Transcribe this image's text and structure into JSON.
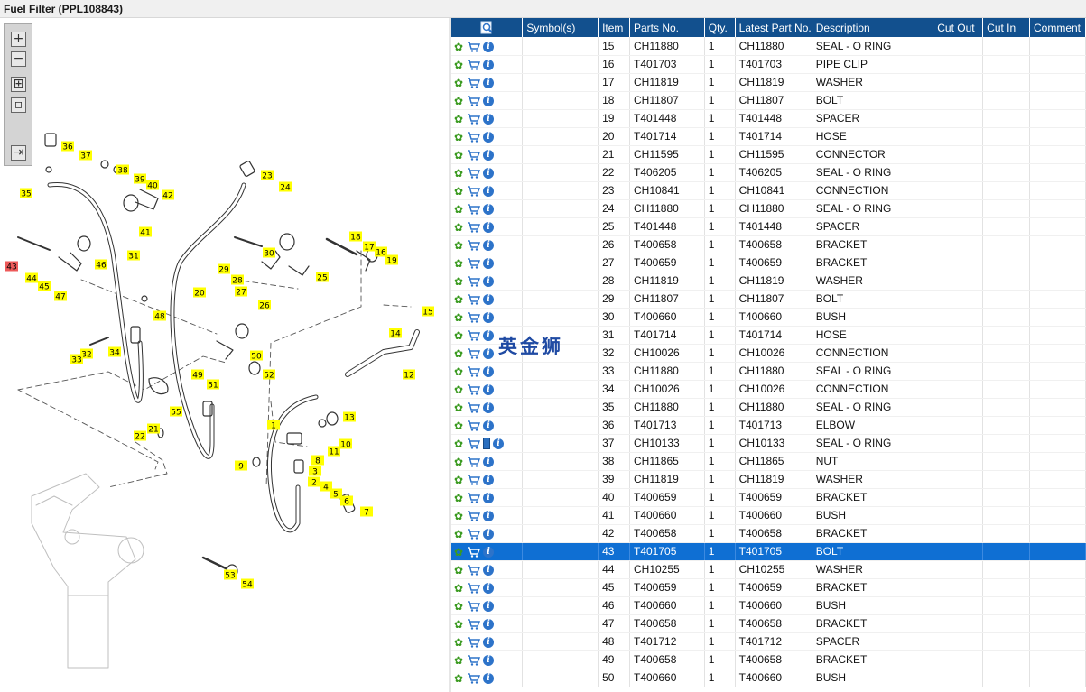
{
  "window": {
    "title": "Fuel Filter (PPL108843)"
  },
  "toolbar": {
    "tools": [
      {
        "name": "zoom-in-icon",
        "glyph": "+"
      },
      {
        "name": "zoom-out-icon",
        "glyph": "−"
      },
      {
        "name": "fit-all-icon",
        "glyph": "⊞"
      },
      {
        "name": "fit-window-icon",
        "glyph": "▫"
      },
      {
        "name": "panel-toggle-icon",
        "glyph": "⇥"
      }
    ]
  },
  "watermark": "英金狮",
  "colors": {
    "header_bg": "#12508e",
    "selected_row": "#0f6fd3",
    "callout": "#ffff00",
    "callout_selected": "#ee5a5a",
    "gear": "#3a9a1f",
    "info": "#2d73c9"
  },
  "diagram": {
    "selected_callout": "43",
    "callouts": [
      {
        "n": "1"
      },
      {
        "n": "2"
      },
      {
        "n": "3"
      },
      {
        "n": "4"
      },
      {
        "n": "5"
      },
      {
        "n": "6"
      },
      {
        "n": "7"
      },
      {
        "n": "8"
      },
      {
        "n": "9"
      },
      {
        "n": "10"
      },
      {
        "n": "11"
      },
      {
        "n": "12"
      },
      {
        "n": "13"
      },
      {
        "n": "14"
      },
      {
        "n": "15"
      },
      {
        "n": "16"
      },
      {
        "n": "17"
      },
      {
        "n": "18"
      },
      {
        "n": "19"
      },
      {
        "n": "20"
      },
      {
        "n": "21"
      },
      {
        "n": "22"
      },
      {
        "n": "23"
      },
      {
        "n": "24"
      },
      {
        "n": "25"
      },
      {
        "n": "26"
      },
      {
        "n": "27"
      },
      {
        "n": "28"
      },
      {
        "n": "29"
      },
      {
        "n": "30"
      },
      {
        "n": "31"
      },
      {
        "n": "32"
      },
      {
        "n": "33"
      },
      {
        "n": "34"
      },
      {
        "n": "35"
      },
      {
        "n": "36"
      },
      {
        "n": "37"
      },
      {
        "n": "38"
      },
      {
        "n": "39"
      },
      {
        "n": "40"
      },
      {
        "n": "41"
      },
      {
        "n": "42"
      },
      {
        "n": "43"
      },
      {
        "n": "44"
      },
      {
        "n": "45"
      },
      {
        "n": "46"
      },
      {
        "n": "47"
      },
      {
        "n": "48"
      },
      {
        "n": "49"
      },
      {
        "n": "50"
      },
      {
        "n": "51"
      },
      {
        "n": "52"
      },
      {
        "n": "53"
      },
      {
        "n": "54"
      },
      {
        "n": "55"
      }
    ]
  },
  "table": {
    "columns": [
      "",
      "Symbol(s)",
      "Item",
      "Parts No.",
      "Qty.",
      "Latest Part No.",
      "Description",
      "Cut Out",
      "Cut In",
      "Comment"
    ],
    "selected_item": "43",
    "rows": [
      {
        "item": "15",
        "part": "CH11880",
        "qty": "1",
        "latest": "CH11880",
        "desc": "SEAL - O RING"
      },
      {
        "item": "16",
        "part": "T401703",
        "qty": "1",
        "latest": "T401703",
        "desc": "PIPE CLIP"
      },
      {
        "item": "17",
        "part": "CH11819",
        "qty": "1",
        "latest": "CH11819",
        "desc": "WASHER"
      },
      {
        "item": "18",
        "part": "CH11807",
        "qty": "1",
        "latest": "CH11807",
        "desc": "BOLT"
      },
      {
        "item": "19",
        "part": "T401448",
        "qty": "1",
        "latest": "T401448",
        "desc": "SPACER"
      },
      {
        "item": "20",
        "part": "T401714",
        "qty": "1",
        "latest": "T401714",
        "desc": "HOSE"
      },
      {
        "item": "21",
        "part": "CH11595",
        "qty": "1",
        "latest": "CH11595",
        "desc": "CONNECTOR"
      },
      {
        "item": "22",
        "part": "T406205",
        "qty": "1",
        "latest": "T406205",
        "desc": "SEAL - O RING"
      },
      {
        "item": "23",
        "part": "CH10841",
        "qty": "1",
        "latest": "CH10841",
        "desc": "CONNECTION"
      },
      {
        "item": "24",
        "part": "CH11880",
        "qty": "1",
        "latest": "CH11880",
        "desc": "SEAL - O RING"
      },
      {
        "item": "25",
        "part": "T401448",
        "qty": "1",
        "latest": "T401448",
        "desc": "SPACER"
      },
      {
        "item": "26",
        "part": "T400658",
        "qty": "1",
        "latest": "T400658",
        "desc": "BRACKET"
      },
      {
        "item": "27",
        "part": "T400659",
        "qty": "1",
        "latest": "T400659",
        "desc": "BRACKET"
      },
      {
        "item": "28",
        "part": "CH11819",
        "qty": "1",
        "latest": "CH11819",
        "desc": "WASHER"
      },
      {
        "item": "29",
        "part": "CH11807",
        "qty": "1",
        "latest": "CH11807",
        "desc": "BOLT"
      },
      {
        "item": "30",
        "part": "T400660",
        "qty": "1",
        "latest": "T400660",
        "desc": "BUSH"
      },
      {
        "item": "31",
        "part": "T401714",
        "qty": "1",
        "latest": "T401714",
        "desc": "HOSE"
      },
      {
        "item": "32",
        "part": "CH10026",
        "qty": "1",
        "latest": "CH10026",
        "desc": "CONNECTION"
      },
      {
        "item": "33",
        "part": "CH11880",
        "qty": "1",
        "latest": "CH11880",
        "desc": "SEAL - O RING"
      },
      {
        "item": "34",
        "part": "CH10026",
        "qty": "1",
        "latest": "CH10026",
        "desc": "CONNECTION"
      },
      {
        "item": "35",
        "part": "CH11880",
        "qty": "1",
        "latest": "CH11880",
        "desc": "SEAL - O RING"
      },
      {
        "item": "36",
        "part": "T401713",
        "qty": "1",
        "latest": "T401713",
        "desc": "ELBOW"
      },
      {
        "item": "37",
        "part": "CH10133",
        "qty": "1",
        "latest": "CH10133",
        "desc": "SEAL - O RING",
        "book": true
      },
      {
        "item": "38",
        "part": "CH11865",
        "qty": "1",
        "latest": "CH11865",
        "desc": "NUT"
      },
      {
        "item": "39",
        "part": "CH11819",
        "qty": "1",
        "latest": "CH11819",
        "desc": "WASHER"
      },
      {
        "item": "40",
        "part": "T400659",
        "qty": "1",
        "latest": "T400659",
        "desc": "BRACKET"
      },
      {
        "item": "41",
        "part": "T400660",
        "qty": "1",
        "latest": "T400660",
        "desc": "BUSH"
      },
      {
        "item": "42",
        "part": "T400658",
        "qty": "1",
        "latest": "T400658",
        "desc": "BRACKET"
      },
      {
        "item": "43",
        "part": "T401705",
        "qty": "1",
        "latest": "T401705",
        "desc": "BOLT"
      },
      {
        "item": "44",
        "part": "CH10255",
        "qty": "1",
        "latest": "CH10255",
        "desc": "WASHER"
      },
      {
        "item": "45",
        "part": "T400659",
        "qty": "1",
        "latest": "T400659",
        "desc": "BRACKET"
      },
      {
        "item": "46",
        "part": "T400660",
        "qty": "1",
        "latest": "T400660",
        "desc": "BUSH"
      },
      {
        "item": "47",
        "part": "T400658",
        "qty": "1",
        "latest": "T400658",
        "desc": "BRACKET"
      },
      {
        "item": "48",
        "part": "T401712",
        "qty": "1",
        "latest": "T401712",
        "desc": "SPACER"
      },
      {
        "item": "49",
        "part": "T400658",
        "qty": "1",
        "latest": "T400658",
        "desc": "BRACKET"
      },
      {
        "item": "50",
        "part": "T400660",
        "qty": "1",
        "latest": "T400660",
        "desc": "BUSH"
      }
    ]
  }
}
